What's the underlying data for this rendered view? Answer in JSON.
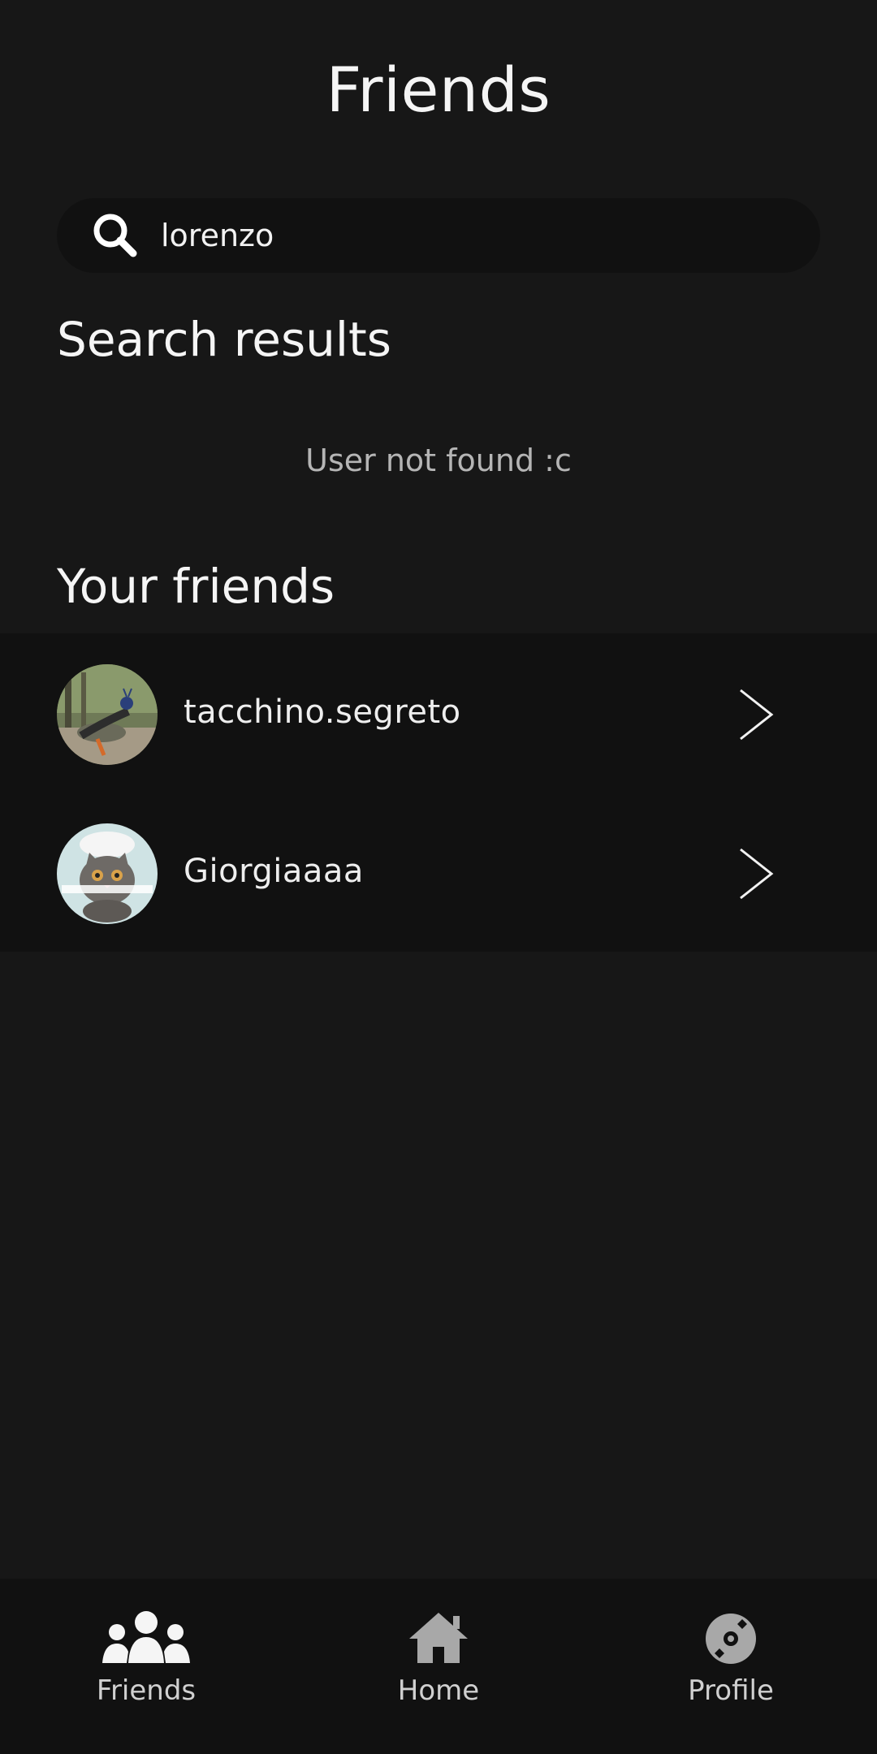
{
  "header": {
    "title": "Friends"
  },
  "search": {
    "icon": "search-icon",
    "value": "lorenzo"
  },
  "search_results": {
    "title": "Search results",
    "empty_message": "User not found :c"
  },
  "friends": {
    "title": "Your friends",
    "items": [
      {
        "name": "tacchino.segreto",
        "avatar": "peacock-photo-avatar"
      },
      {
        "name": "Giorgiaaaa",
        "avatar": "kitten-chef-photo-avatar"
      }
    ]
  },
  "nav": {
    "items": [
      {
        "label": "Friends",
        "icon": "friends-icon"
      },
      {
        "label": "Home",
        "icon": "home-icon"
      },
      {
        "label": "Profile",
        "icon": "vinyl-disc-icon"
      }
    ]
  },
  "colors": {
    "background": "#171717",
    "surface": "#111111",
    "text": "#f2f2f2",
    "muted_text": "#b5b5b5"
  }
}
